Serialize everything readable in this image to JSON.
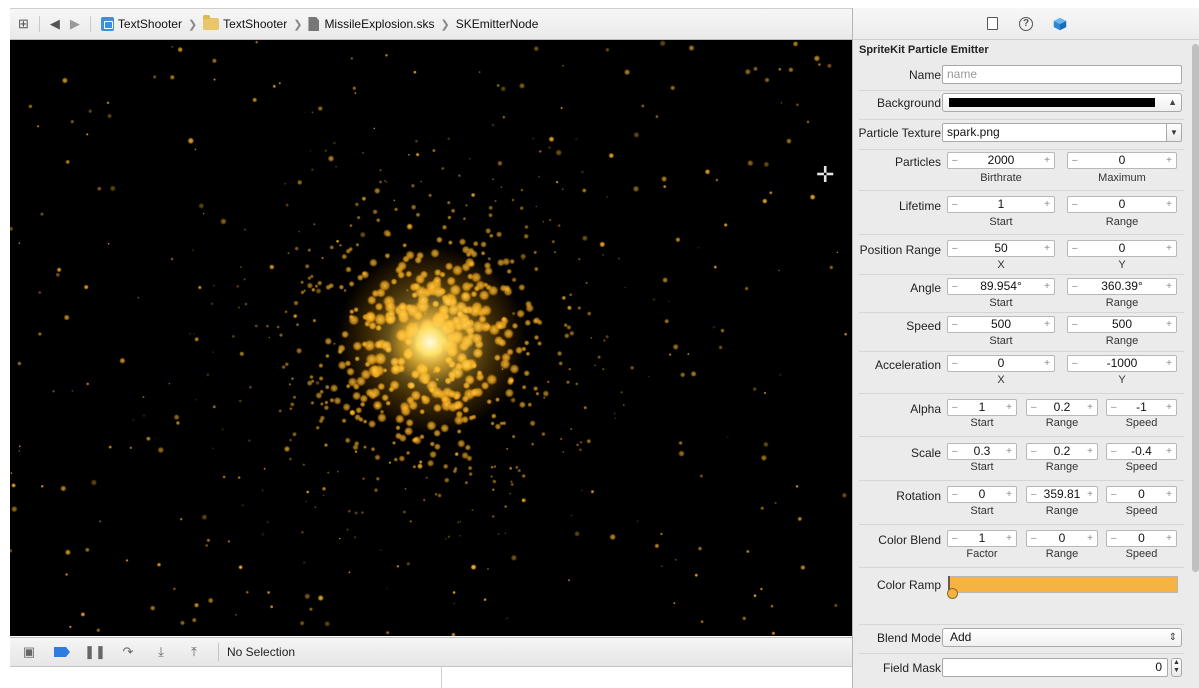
{
  "breadcrumb": {
    "items": [
      {
        "label": "TextShooter",
        "icon": "project-icon"
      },
      {
        "label": "TextShooter",
        "icon": "folder-icon"
      },
      {
        "label": "MissileExplosion.sks",
        "icon": "file-icon"
      },
      {
        "label": "SKEmitterNode",
        "icon": ""
      }
    ]
  },
  "debug": {
    "status": "No Selection"
  },
  "inspector": {
    "title": "SpriteKit Particle Emitter",
    "name": {
      "label": "Name",
      "placeholder": "name"
    },
    "background": {
      "label": "Background",
      "color": "#000000"
    },
    "texture": {
      "label": "Particle Texture",
      "value": "spark.png"
    },
    "particles": {
      "label": "Particles",
      "birthrate": "2000",
      "maximum": "0",
      "birthrate_label": "Birthrate",
      "maximum_label": "Maximum"
    },
    "lifetime": {
      "label": "Lifetime",
      "start": "1",
      "range": "0",
      "start_label": "Start",
      "range_label": "Range"
    },
    "position_range": {
      "label": "Position Range",
      "x": "50",
      "y": "0",
      "x_label": "X",
      "y_label": "Y"
    },
    "angle": {
      "label": "Angle",
      "start": "89.954°",
      "range": "360.39°",
      "start_label": "Start",
      "range_label": "Range"
    },
    "speed": {
      "label": "Speed",
      "start": "500",
      "range": "500",
      "start_label": "Start",
      "range_label": "Range"
    },
    "acceleration": {
      "label": "Acceleration",
      "x": "0",
      "y": "-1000",
      "x_label": "X",
      "y_label": "Y"
    },
    "alpha": {
      "label": "Alpha",
      "start": "1",
      "range": "0.2",
      "speed": "-1",
      "start_label": "Start",
      "range_label": "Range",
      "speed_label": "Speed"
    },
    "scale": {
      "label": "Scale",
      "start": "0.3",
      "range": "0.2",
      "speed": "-0.4",
      "start_label": "Start",
      "range_label": "Range",
      "speed_label": "Speed"
    },
    "rotation": {
      "label": "Rotation",
      "start": "0",
      "range": "359.81",
      "speed": "0",
      "start_label": "Start",
      "range_label": "Range",
      "speed_label": "Speed"
    },
    "color_blend": {
      "label": "Color Blend",
      "factor": "1",
      "range": "0",
      "speed": "0",
      "factor_label": "Factor",
      "range_label": "Range",
      "speed_label": "Speed"
    },
    "color_ramp": {
      "label": "Color Ramp",
      "color": "#f6b341"
    },
    "blend_mode": {
      "label": "Blend Mode",
      "value": "Add"
    },
    "field_mask": {
      "label": "Field Mask",
      "value": "0"
    }
  },
  "colors": {
    "particle": "#ffb21a",
    "particle_core": "#fff2b0"
  }
}
